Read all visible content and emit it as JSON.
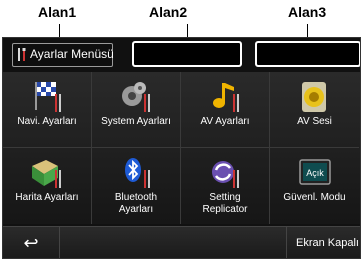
{
  "callouts": {
    "area1": "Alan1",
    "area2": "Alan2",
    "area3": "Alan3"
  },
  "header": {
    "title": "Ayarlar Menüsü",
    "icon": "wrench-screwdriver-icon"
  },
  "tiles": [
    {
      "label": "Navi. Ayarları",
      "icon": "checkered-flag-icon"
    },
    {
      "label": "System Ayarları",
      "icon": "gears-icon"
    },
    {
      "label": "AV Ayarları",
      "icon": "music-note-icon"
    },
    {
      "label": "AV Sesi",
      "icon": "speaker-icon"
    },
    {
      "label": "Harita Ayarları",
      "icon": "map-icon"
    },
    {
      "label": "Bluetooth Ayarları",
      "icon": "bluetooth-icon"
    },
    {
      "label": "Setting Replicator",
      "icon": "sync-arrows-icon"
    },
    {
      "label": "Güvenl. Modu",
      "icon": "safety-display-icon",
      "badge": "Açık"
    }
  ],
  "footer": {
    "back_icon": "back-arrow-icon",
    "screen_off_label": "Ekran Kapalı"
  },
  "colors": {
    "screen_bg": "#111111",
    "frame": "#9a9a9a",
    "accent_gold": "#f0b400",
    "bluetooth_blue": "#1e5bd6"
  }
}
